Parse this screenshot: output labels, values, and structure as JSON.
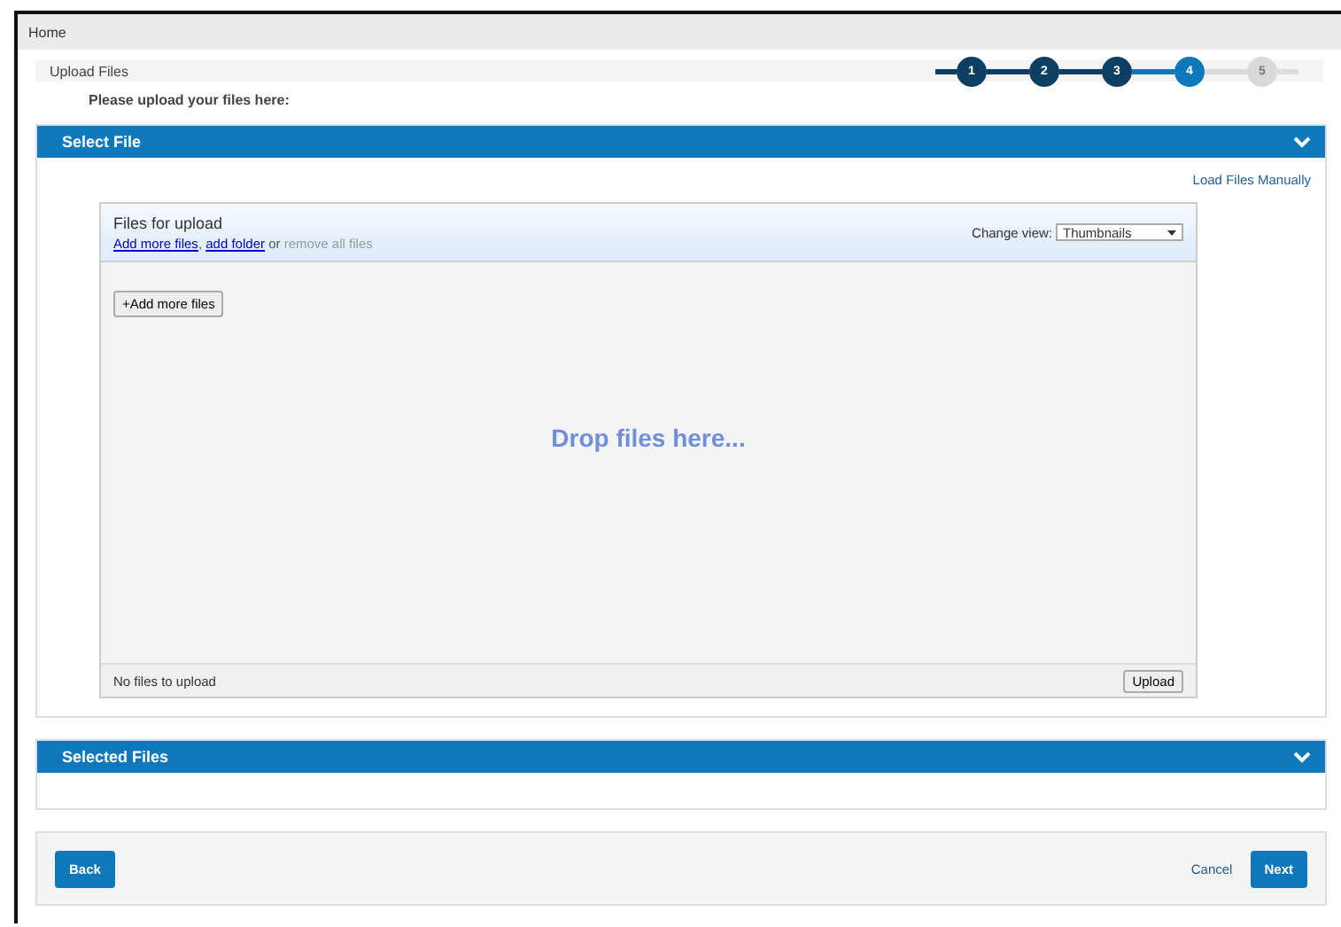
{
  "breadcrumb": "Home",
  "page_title": "Upload Files",
  "steps": [
    {
      "label": "1",
      "completed": true,
      "selected": false
    },
    {
      "label": "2",
      "completed": true,
      "selected": false
    },
    {
      "label": "3",
      "completed": true,
      "selected": false
    },
    {
      "label": "4",
      "completed": false,
      "selected": true
    },
    {
      "label": "5",
      "completed": false,
      "selected": false
    }
  ],
  "instruction": "Please upload your files here:",
  "select_panel": {
    "title": "Select File",
    "manual_link": "Load Files Manually",
    "uploader": {
      "title": "Files for upload",
      "add_files_link": "Add more files",
      "separator": ",",
      "add_folder_link": "add folder",
      "or_text": "or",
      "remove_all": "remove all files",
      "change_view_label": "Change view:",
      "view_value": "Thumbnails",
      "add_button": "+Add more files",
      "drop_text": "Drop files here...",
      "status": "No files to upload",
      "upload_button": "Upload"
    }
  },
  "selected_panel": {
    "title": "Selected Files"
  },
  "footer": {
    "back": "Back",
    "cancel": "Cancel",
    "next": "Next"
  }
}
